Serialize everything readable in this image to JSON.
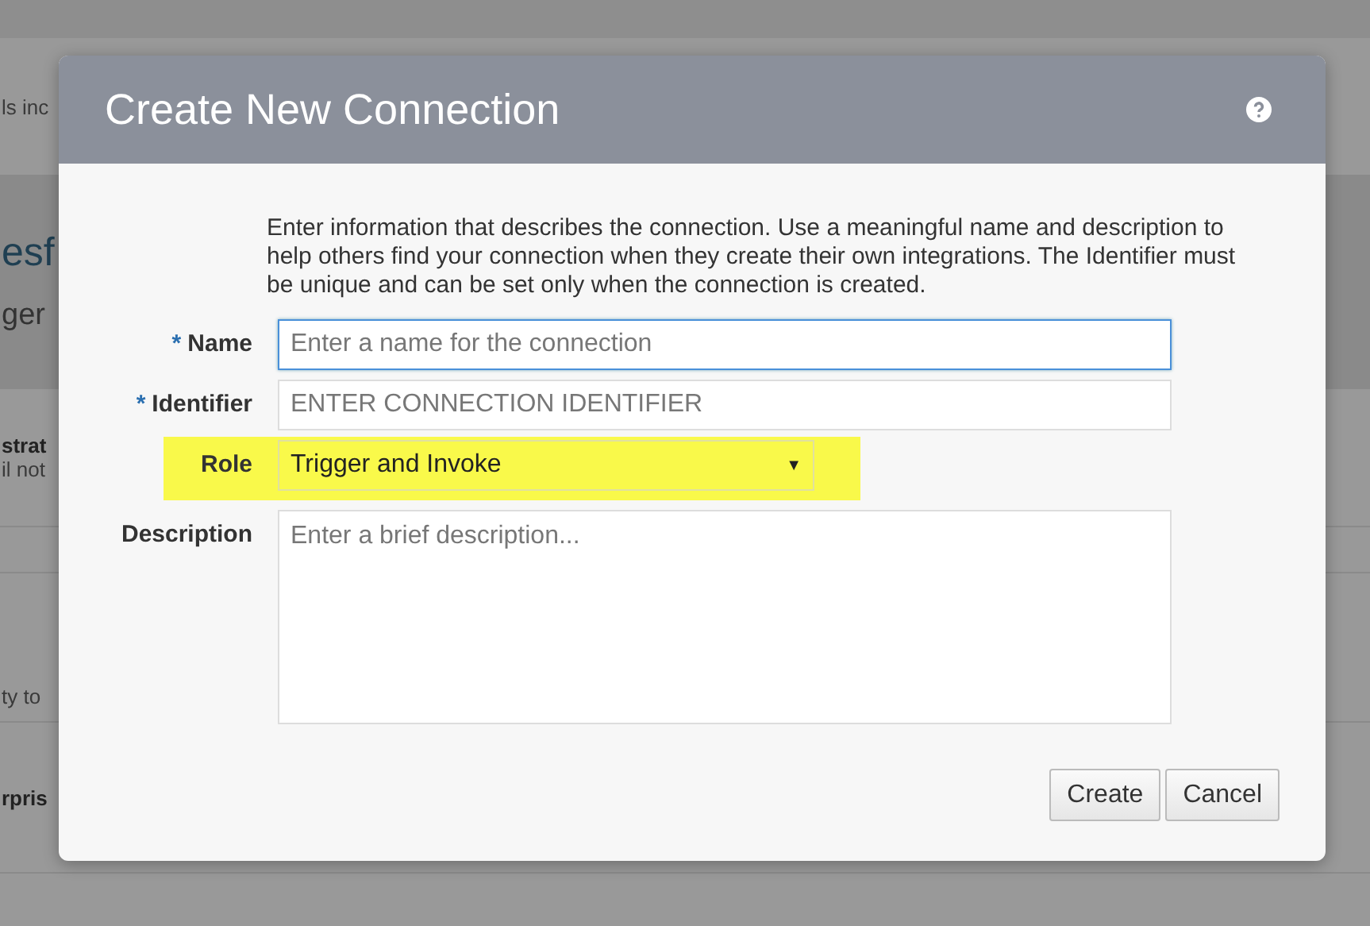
{
  "background": {
    "texts": [
      {
        "kind": "small",
        "text": "ls inc"
      },
      {
        "kind": "heading",
        "text": "esf"
      },
      {
        "kind": "subheading",
        "text": "ger"
      },
      {
        "kind": "bold",
        "text": "strat"
      },
      {
        "kind": "small",
        "text": "il not"
      },
      {
        "kind": "small",
        "text": "ty to"
      },
      {
        "kind": "bold",
        "text": "rpris"
      }
    ]
  },
  "dialog": {
    "title": "Create New Connection",
    "intro": "Enter information that describes the connection. Use a meaningful name and description to help others find your connection when they create their own integrations. The Identifier must be unique and can be set only when the connection is created.",
    "fields": [
      {
        "kind": "text",
        "label": "Name",
        "required_mark": "*",
        "placeholder": "Enter a name for the connection",
        "focused": true,
        "highlighted": false
      },
      {
        "kind": "text",
        "label": "Identifier",
        "required_mark": "*",
        "placeholder": "ENTER CONNECTION IDENTIFIER",
        "focused": false,
        "highlighted": false
      },
      {
        "kind": "select",
        "label": "Role",
        "value": "Trigger and Invoke",
        "caret": "▼",
        "highlighted": true
      },
      {
        "kind": "textarea",
        "label": "Description",
        "placeholder": "Enter a brief description...",
        "focused": false,
        "highlighted": false
      }
    ],
    "buttons": [
      "Create",
      "Cancel"
    ]
  }
}
